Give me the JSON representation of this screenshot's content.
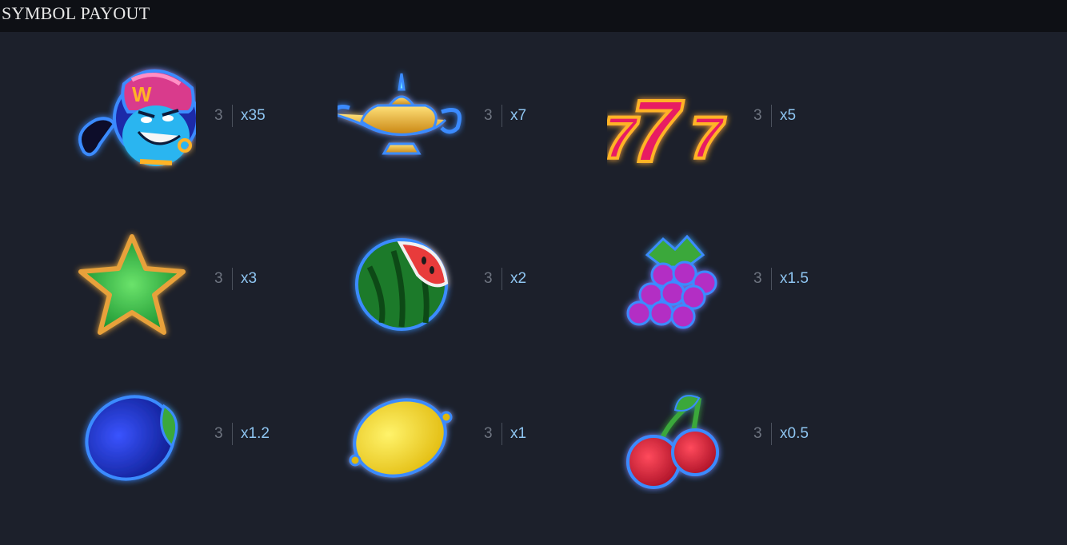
{
  "header": {
    "title": "SYMBOL PAYOUT"
  },
  "symbols": [
    {
      "name": "Genie",
      "icon": "genie-icon",
      "count": "3",
      "multiplier": "x35"
    },
    {
      "name": "Lamp",
      "icon": "lamp-icon",
      "count": "3",
      "multiplier": "x7"
    },
    {
      "name": "Sevens",
      "icon": "triple-seven-icon",
      "count": "3",
      "multiplier": "x5"
    },
    {
      "name": "Star",
      "icon": "star-icon",
      "count": "3",
      "multiplier": "x3"
    },
    {
      "name": "Watermelon",
      "icon": "watermelon-icon",
      "count": "3",
      "multiplier": "x2"
    },
    {
      "name": "Grapes",
      "icon": "grapes-icon",
      "count": "3",
      "multiplier": "x1.5"
    },
    {
      "name": "Plum",
      "icon": "plum-icon",
      "count": "3",
      "multiplier": "x1.2"
    },
    {
      "name": "Lemon",
      "icon": "lemon-icon",
      "count": "3",
      "multiplier": "x1"
    },
    {
      "name": "Cherry",
      "icon": "cherry-icon",
      "count": "3",
      "multiplier": "x0.5"
    }
  ],
  "colors": {
    "background": "#1c202b",
    "header": "#0e1015",
    "glow": "#2f7bff",
    "count_text": "#6e7480",
    "multiplier_text": "#8fc6f2"
  }
}
